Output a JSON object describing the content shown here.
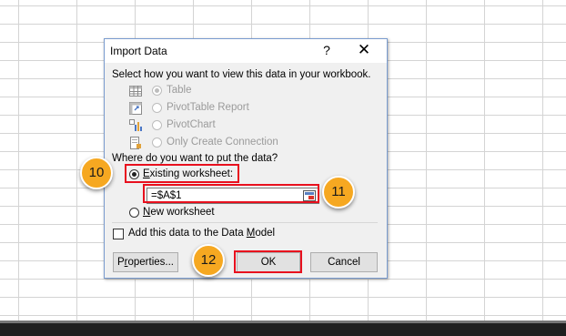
{
  "dialog": {
    "title": "Import Data",
    "help_glyph": "?",
    "close_glyph": "✕",
    "view_prompt": "Select how you want to view this data in your workbook.",
    "view_options": [
      {
        "label": "Table",
        "icon": "table-icon",
        "selected": true,
        "enabled": false
      },
      {
        "label": "PivotTable Report",
        "icon": "pivottable-icon",
        "selected": false,
        "enabled": false
      },
      {
        "label": "PivotChart",
        "icon": "pivotchart-icon",
        "selected": false,
        "enabled": false
      },
      {
        "label": "Only Create Connection",
        "icon": "connection-icon",
        "selected": false,
        "enabled": false
      }
    ],
    "destination_prompt": "Where do you want to put the data?",
    "existing_worksheet": {
      "label_pre": "",
      "label_mnemonic": "E",
      "label_post": "xisting worksheet:",
      "selected": true
    },
    "cell_reference": "=$A$1",
    "new_worksheet": {
      "label_mnemonic": "N",
      "label_post": "ew worksheet",
      "selected": false
    },
    "data_model": {
      "label_pre": "Add this data to the Data ",
      "label_mnemonic": "M",
      "label_post": "odel",
      "checked": false
    },
    "buttons": {
      "properties_pre": "P",
      "properties_mnemonic": "r",
      "properties_post": "operties...",
      "ok": "OK",
      "cancel": "Cancel"
    }
  },
  "callouts": {
    "step_10": "10",
    "step_11": "11",
    "step_12": "12"
  },
  "colors": {
    "highlight_border": "#e8101e",
    "callout_fill": "#f6a821",
    "dialog_border": "#7a9ccf"
  }
}
